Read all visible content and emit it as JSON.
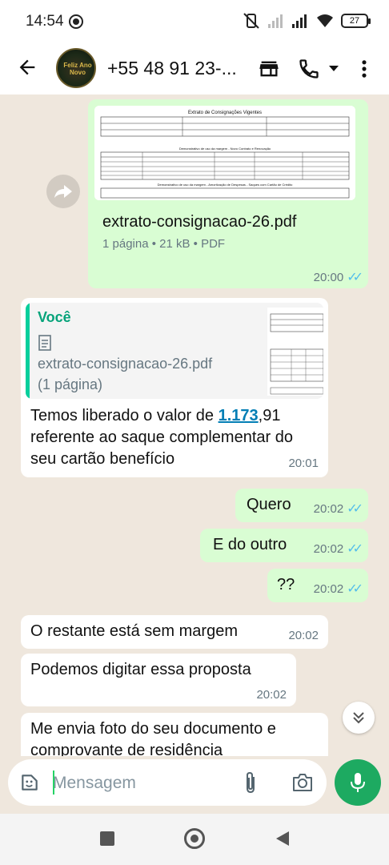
{
  "status_bar": {
    "time": "14:54",
    "battery": "27"
  },
  "header": {
    "contact_name": "+55 48 91 23-...",
    "avatar_text": "Feliz Ano Novo"
  },
  "pdf_preview": {
    "doc_title": "Extrato de Consignações Vigentes",
    "section_1": "Demonstrativo de uso da margem - Novo Contrato e Renovação",
    "section_2": "Demonstrativo de uso da margem - Amortização de Despesas - Saques com Cartão de Crédito"
  },
  "messages": [
    {
      "direction": "outgoing",
      "type": "document",
      "forwarded": true,
      "filename": "extrato-consignacao-26.pdf",
      "details": "1 página • 21 kB • PDF",
      "time": "20:00",
      "read": true
    },
    {
      "direction": "incoming",
      "type": "reply",
      "quote_author": "Você",
      "quote_filename": "extrato-consignacao-26.pdf",
      "quote_pages": "(1 página)",
      "text_before": "Temos liberado o valor de ",
      "link_text": "1.173",
      "text_after": ",91 referente ao saque complementar do seu cartão benefício",
      "time": "20:01"
    },
    {
      "direction": "outgoing",
      "text": "Quero",
      "time": "20:02",
      "read": true
    },
    {
      "direction": "outgoing",
      "text": "E do outro",
      "time": "20:02",
      "read": true
    },
    {
      "direction": "outgoing",
      "text": "??",
      "time": "20:02",
      "read": true
    },
    {
      "direction": "incoming",
      "text": "O restante está sem margem",
      "time": "20:02"
    },
    {
      "direction": "incoming",
      "text": "Podemos digitar essa proposta",
      "time": "20:02"
    },
    {
      "direction": "incoming",
      "text": "Me envia foto do seu documento e comprovante de residência",
      "time": ""
    }
  ],
  "composer": {
    "placeholder": "Mensagem"
  },
  "colors": {
    "outgoing_bubble": "#d9fdd3",
    "incoming_bubble": "#ffffff",
    "chat_background": "#efe7dd",
    "read_ticks": "#53bdeb",
    "mic_button": "#1daa61",
    "link": "#027eb5"
  },
  "icons": {
    "back": "arrow-left-icon",
    "store": "store-icon",
    "call": "phone-icon",
    "call_menu": "caret-down-icon",
    "more": "more-vert-icon",
    "forward": "forward-icon",
    "document": "document-icon",
    "scroll_down": "double-chevron-down-icon",
    "sticker": "sticker-icon",
    "attach": "paperclip-icon",
    "camera": "camera-icon",
    "mic": "microphone-icon"
  }
}
